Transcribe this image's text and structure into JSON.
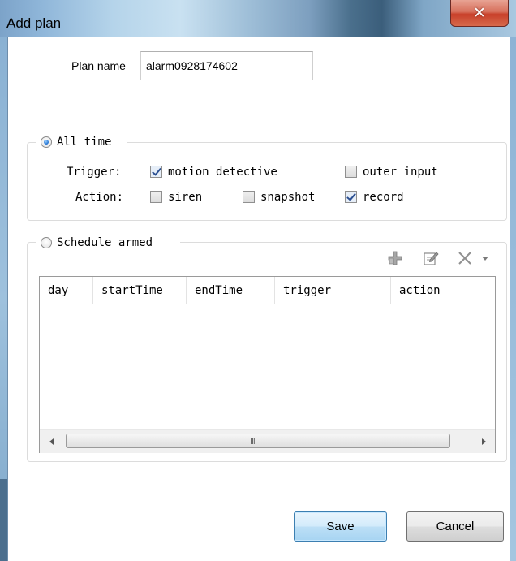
{
  "window": {
    "title": "Add plan",
    "close_symbol": "✕"
  },
  "plan_name": {
    "label": "Plan name",
    "value": "alarm0928174602"
  },
  "all_time": {
    "label": "All time",
    "selected": true,
    "trigger_label": "Trigger:",
    "action_label": "Action:",
    "triggers": [
      {
        "label": "motion detective",
        "checked": true
      },
      {
        "label": "outer input",
        "checked": false
      }
    ],
    "actions": [
      {
        "label": "siren",
        "checked": false
      },
      {
        "label": "snapshot",
        "checked": false
      },
      {
        "label": "record",
        "checked": true
      }
    ]
  },
  "schedule": {
    "label": "Schedule armed",
    "selected": false,
    "toolbar": [
      "add-icon",
      "edit-icon",
      "delete-icon",
      "dropdown-arrow-icon"
    ],
    "columns": [
      "day",
      "startTime",
      "endTime",
      "trigger",
      "action"
    ],
    "rows": [],
    "scroll_grip": "III"
  },
  "buttons": {
    "save": "Save",
    "cancel": "Cancel"
  },
  "colors": {
    "close_button": "#c8402a",
    "save_button_border": "#3c7fb1",
    "checkmark": "#2b4f92"
  }
}
